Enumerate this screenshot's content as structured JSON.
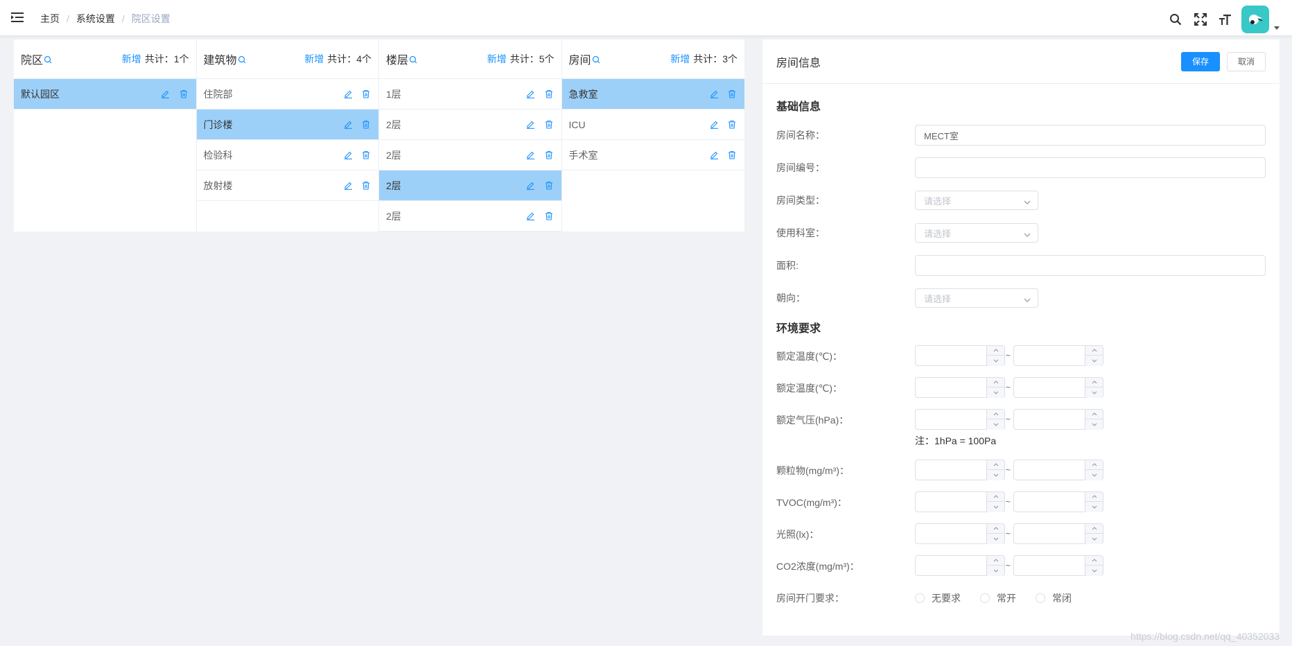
{
  "breadcrumb": {
    "home": "主页",
    "level2": "系统设置",
    "current": "院区设置",
    "sep": "/"
  },
  "columns": [
    {
      "title": "院区",
      "add": "新增",
      "count": "共计：1个",
      "rows": [
        {
          "label": "默认园区",
          "active": true
        }
      ]
    },
    {
      "title": "建筑物",
      "add": "新增",
      "count": "共计：4个",
      "rows": [
        {
          "label": "住院部",
          "active": false
        },
        {
          "label": "门诊楼",
          "active": true
        },
        {
          "label": "检验科",
          "active": false
        },
        {
          "label": "放射楼",
          "active": false
        }
      ]
    },
    {
      "title": "楼层",
      "add": "新增",
      "count": "共计：5个",
      "rows": [
        {
          "label": "1层",
          "active": false
        },
        {
          "label": "2层",
          "active": false
        },
        {
          "label": "2层",
          "active": false
        },
        {
          "label": "2层",
          "active": true
        },
        {
          "label": "2层",
          "active": false
        }
      ]
    },
    {
      "title": "房间",
      "add": "新增",
      "count": "共计：3个",
      "rows": [
        {
          "label": "急救室",
          "active": true
        },
        {
          "label": "ICU",
          "active": false
        },
        {
          "label": "手术室",
          "active": false
        }
      ]
    }
  ],
  "info": {
    "title": "房间信息",
    "save": "保存",
    "cancel": "取消",
    "basic_title": "基础信息",
    "room_name_label": "房间名称：",
    "room_name_value": "MECT室",
    "room_no_label": "房间编号：",
    "room_type_label": "房间类型：",
    "dept_label": "使用科室：",
    "area_label": "面积:",
    "orient_label": "朝向：",
    "select_placeholder": "请选择",
    "env_title": "环境要求",
    "temp1_label": "额定温度(℃)：",
    "temp2_label": "额定温度(℃)：",
    "pressure_label": "额定气压(hPa)：",
    "pressure_note": "注：1hPa = 100Pa",
    "pm_label": "颗粒物(mg/m³)：",
    "tvoc_label": "TVOC(mg/m³)：",
    "light_label": "光照(lx)：",
    "co2_label": "CO2浓度(mg/m³)：",
    "range_sep": "~",
    "door_label": "房间开门要求：",
    "door_options": [
      "无要求",
      "常开",
      "常闭"
    ]
  },
  "watermark": "https://blog.csdn.net/qq_40352033",
  "colors": {
    "primary": "#1890ff",
    "active_row": "#9dd0f8",
    "bg": "#f0f2f5",
    "avatar": "#38c8c8"
  }
}
